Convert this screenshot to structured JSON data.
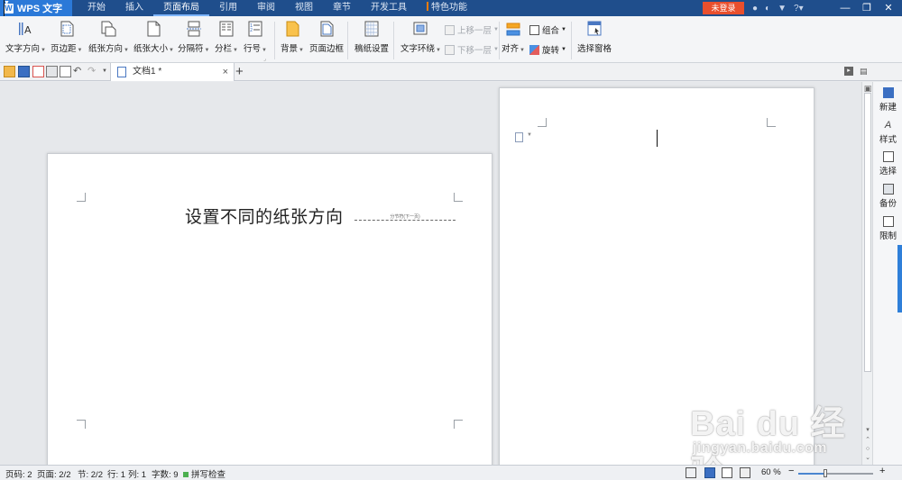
{
  "app": {
    "name": "WPS 文字",
    "login_label": "未登录",
    "help_label": "?"
  },
  "menu_tabs": [
    "开始",
    "插入",
    "页面布局",
    "引用",
    "审阅",
    "视图",
    "章节",
    "开发工具",
    "特色功能"
  ],
  "active_tab": "页面布局",
  "ribbon": {
    "text_direction": "文字方向",
    "margins": "页边距",
    "orientation": "纸张方向",
    "size": "纸张大小",
    "separator": "分隔符",
    "columns": "分栏",
    "line_numbers": "行号",
    "background": "背景",
    "page_border": "页面边框",
    "manuscript": "稿纸设置",
    "text_wrap": "文字环绕",
    "bring_forward": "上移一层",
    "send_backward": "下移一层",
    "align": "对齐",
    "group": "组合",
    "rotate": "旋转",
    "selection_pane": "选择窗格"
  },
  "document_tab": {
    "title": "文档1 *",
    "close": "×",
    "new_tab": "+"
  },
  "document": {
    "heading": "设置不同的纸张方向",
    "section_break": "分节符(下一页)"
  },
  "side_pane": {
    "new": "新建",
    "style": "样式",
    "select": "选择",
    "backup": "备份",
    "restrict": "限制"
  },
  "status": {
    "page_number": "页码: 2",
    "pages": "页面: 2/2",
    "section": "节: 2/2",
    "row": "行: 1",
    "column": "列: 1",
    "word_count": "字数: 9",
    "spell_check": "拼写检查",
    "zoom": "60 %",
    "zoom_minus": "−",
    "zoom_plus": "+",
    "zoom_fraction": 0.36
  },
  "watermark": {
    "brand": "Bai du 经验",
    "url": "jingyan.baidu.com"
  },
  "colors": {
    "titlebar": "#1f4e8c",
    "app_button": "#2b79d8",
    "login": "#e94f2d",
    "accent": "#2f7fd9"
  }
}
